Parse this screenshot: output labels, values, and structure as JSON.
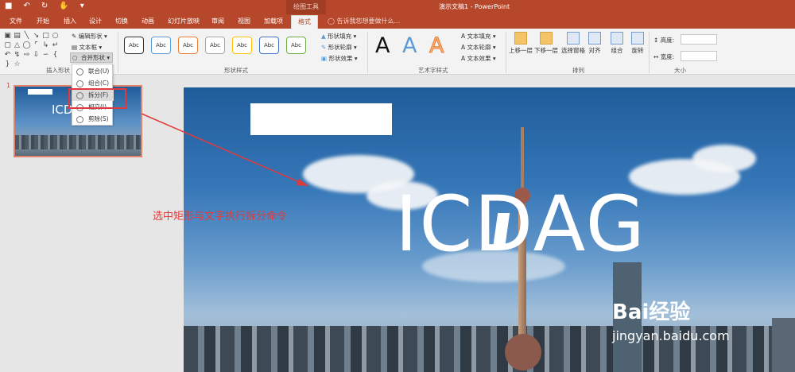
{
  "titlebar": {
    "context_label": "绘图工具",
    "doc_title": "演示文稿1 - PowerPoint"
  },
  "tabs": [
    "文件",
    "开始",
    "插入",
    "设计",
    "切换",
    "动画",
    "幻灯片放映",
    "审阅",
    "视图",
    "加载项",
    "格式"
  ],
  "tell_me": "告诉我您想要做什么...",
  "ribbon": {
    "insert_shapes": {
      "edit_shape": "编辑形状",
      "text_box": "文本框",
      "merge_shapes": "合并形状",
      "group_label": "插入形状"
    },
    "shape_styles": {
      "sample": "Abc",
      "fill": "形状填充",
      "outline": "形状轮廓",
      "effects": "形状效果",
      "group_label": "形状样式"
    },
    "wordart": {
      "sample": "A",
      "text_fill": "文本填充",
      "text_outline": "文本轮廓",
      "text_effects": "文本效果",
      "group_label": "艺术字样式"
    },
    "arrange": {
      "bring_forward": "上移一层",
      "send_backward": "下移一层",
      "selection_pane": "选择窗格",
      "align": "对齐",
      "group": "组合",
      "rotate": "旋转",
      "group_label": "排列"
    },
    "size": {
      "height": "高度:",
      "width": "宽度:",
      "group_label": "大小"
    }
  },
  "merge_menu": [
    {
      "label": "联合(U)"
    },
    {
      "label": "组合(C)"
    },
    {
      "label": "拆分(F)"
    },
    {
      "label": "相交(I)"
    },
    {
      "label": "剪除(S)"
    }
  ],
  "thumbnail": {
    "number": "1",
    "text": "ICDAG"
  },
  "slide": {
    "text": "ICDAG"
  },
  "annotation": "选中矩形与文字执行拆分命令",
  "watermark": {
    "logo": "Bai经验",
    "url": "jingyan.baidu.com"
  },
  "colors": {
    "accent": "#b7472a",
    "annotation_red": "#e23a3a"
  }
}
